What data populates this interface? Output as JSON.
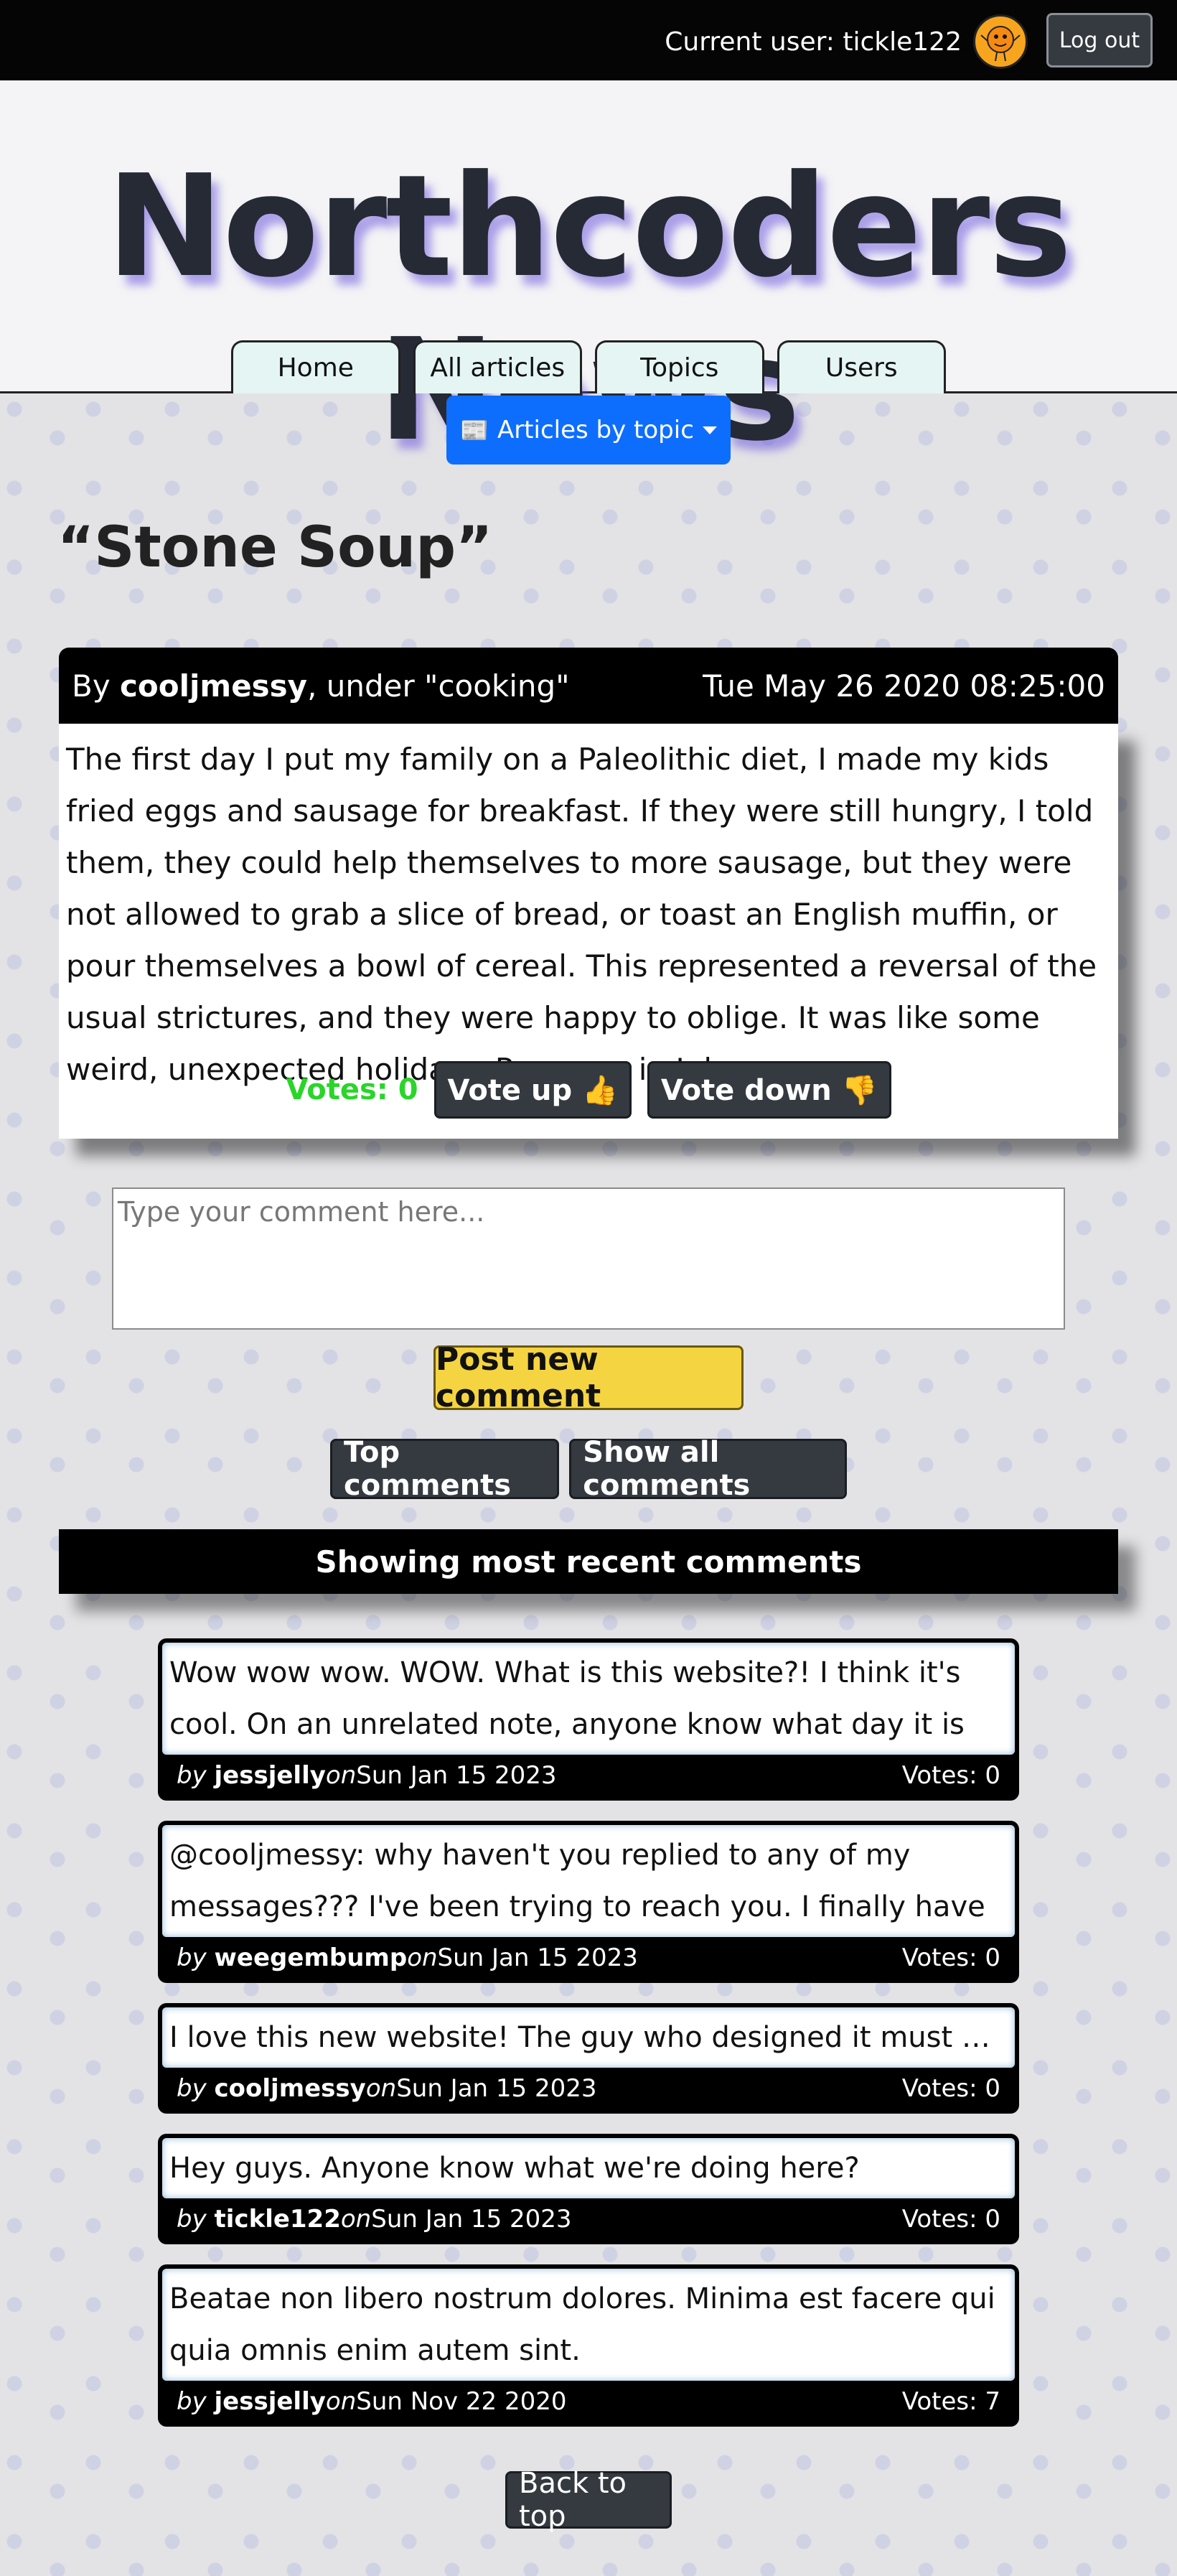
{
  "topbar": {
    "current_user_label": "Current user: tickle122",
    "logout_label": "Log out"
  },
  "header": {
    "site_title": "Northcoders News",
    "nav": [
      {
        "label": "Home"
      },
      {
        "label": "All articles"
      },
      {
        "label": "Topics"
      },
      {
        "label": "Users"
      }
    ],
    "topic_dropdown_label": "Articles by topic",
    "topic_dropdown_icon": "📰"
  },
  "article": {
    "title": "“Stone Soup”",
    "byline_prefix": "By ",
    "author": "cooljmessy",
    "topic_text": ", under \"cooking\"",
    "date": "Tue May 26 2020 08:25:00",
    "body": "The first day I put my family on a Paleolithic diet, I made my kids fried eggs and sausage for breakfast. If they were still hungry, I told them, they could help themselves to more sausage, but they were not allowed to grab a slice of bread, or toast an English muffin, or pour themselves a bowl of cereal. This represented a reversal of the usual strictures, and they were happy to oblige. It was like some weird, unexpected holiday—Passover in July.",
    "votes_label": "Votes: 0",
    "vote_up_label": "Vote up 👍",
    "vote_down_label": "Vote down 👎"
  },
  "comment_form": {
    "placeholder": "Type your comment here...",
    "post_label": "Post new comment"
  },
  "comment_controls": {
    "top_label": "Top comments",
    "all_label": "Show all comments",
    "heading": "Showing most recent comments"
  },
  "comments": [
    {
      "body": "Wow wow wow. WOW. What is this website?! I think it's cool. On an unrelated note, anyone know what day it is today? I would check my...",
      "by": "by",
      "author": "jessjelly",
      "on": "on",
      "date": "Sun Jan 15 2023",
      "votes": "Votes: 0"
    },
    {
      "body": "@cooljmessy: why haven't you replied to any of my messages??? I've been trying to reach you. I finally have a solution for that coding...",
      "by": "by",
      "author": "weegembump",
      "on": "on",
      "date": "Sun Jan 15 2023",
      "votes": "Votes: 0"
    },
    {
      "body": "I love this new website! The guy who designed it must be amazing.",
      "by": "by",
      "author": "cooljmessy",
      "on": "on",
      "date": "Sun Jan 15 2023",
      "votes": "Votes: 0"
    },
    {
      "body": "Hey guys. Anyone know what we're doing here?",
      "by": "by",
      "author": "tickle122",
      "on": "on",
      "date": "Sun Jan 15 2023",
      "votes": "Votes: 0"
    },
    {
      "body": "Beatae non libero nostrum dolores. Minima est facere qui quia omnis enim autem sint.",
      "by": "by",
      "author": "jessjelly",
      "on": "on",
      "date": "Sun Nov 22 2020",
      "votes": "Votes: 7"
    }
  ],
  "back_to_top_label": "Back to top"
}
